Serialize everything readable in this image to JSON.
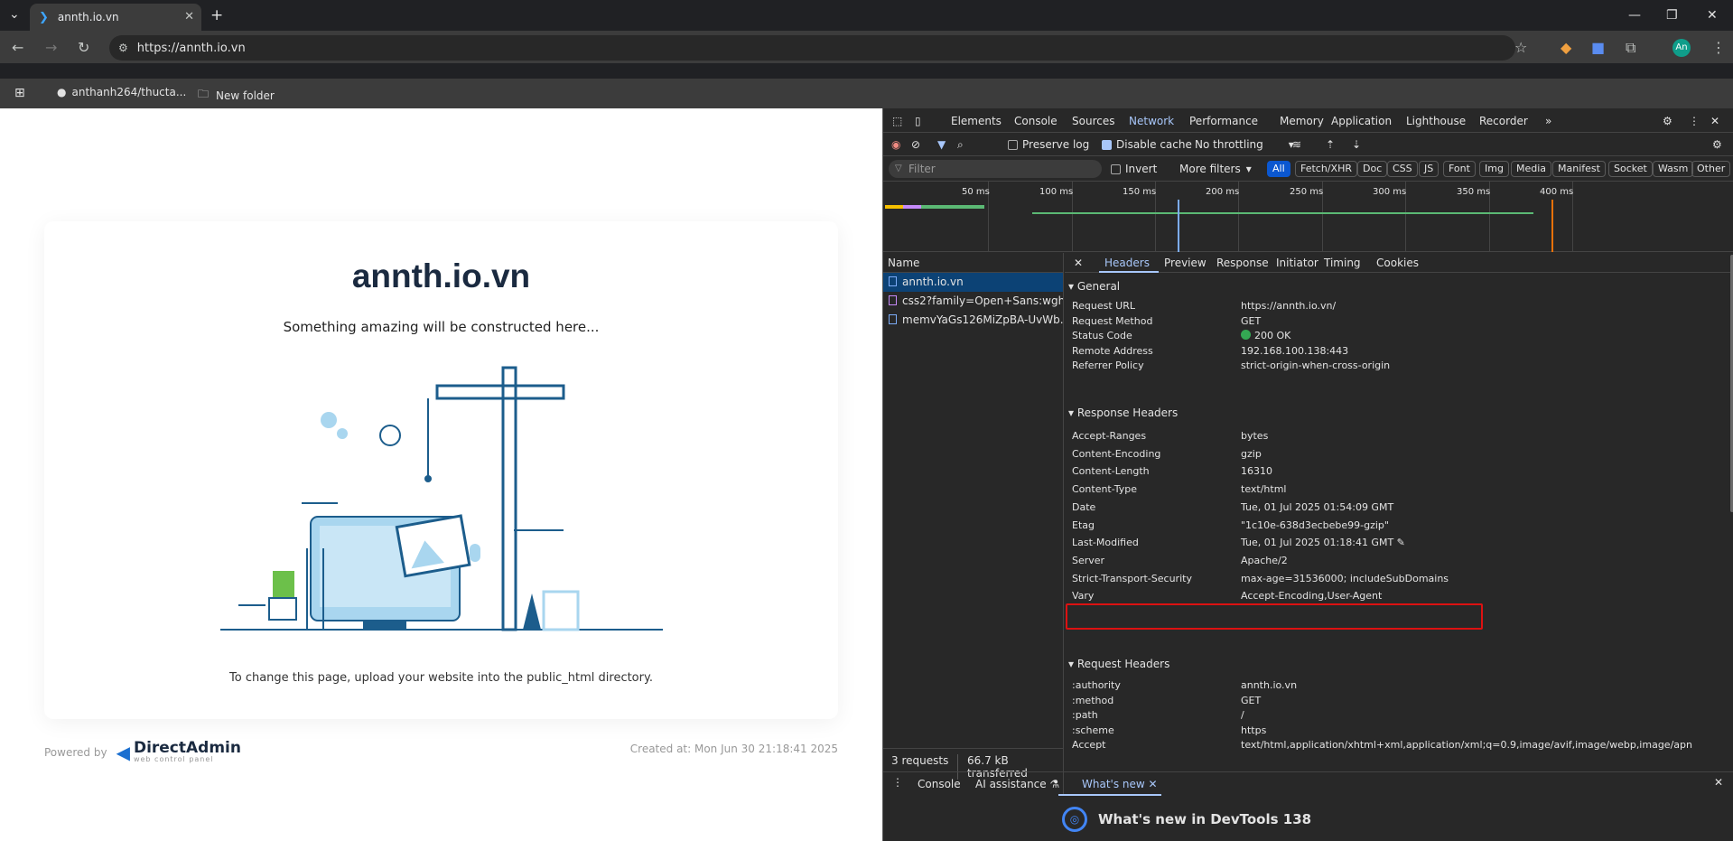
{
  "browser": {
    "tab_title": "annth.io.vn",
    "url": "https://annth.io.vn",
    "bookmarks": [
      "anthanh264/thucta...",
      "New folder"
    ],
    "profile": "An"
  },
  "page": {
    "title": "annth.io.vn",
    "subtitle": "Something amazing will be constructed here...",
    "footer_note": "To change this page, upload your website into the public_html directory.",
    "powered_by": "Powered by",
    "brand": "DirectAdmin",
    "brand_tag": "web control panel",
    "created": "Created at: Mon Jun 30 21:18:41 2025"
  },
  "devtools": {
    "tabs": [
      "Elements",
      "Console",
      "Sources",
      "Network",
      "Performance",
      "Memory",
      "Application",
      "Lighthouse",
      "Recorder"
    ],
    "net": {
      "preserve_log": "Preserve log",
      "disable_cache": "Disable cache",
      "throttling": "No throttling"
    },
    "filter": {
      "placeholder": "Filter",
      "invert": "Invert",
      "more": "More filters",
      "chips": [
        "All",
        "Fetch/XHR",
        "Doc",
        "CSS",
        "JS",
        "Font",
        "Img",
        "Media",
        "Manifest",
        "Socket",
        "Wasm",
        "Other"
      ]
    },
    "ticks": [
      "50 ms",
      "100 ms",
      "150 ms",
      "200 ms",
      "250 ms",
      "300 ms",
      "350 ms",
      "400 ms"
    ],
    "name_header": "Name",
    "requests": [
      "annth.io.vn",
      "css2?family=Open+Sans:wght...",
      "memvYaGs126MiZpBA-UvWb..."
    ],
    "status": {
      "count": "3 requests",
      "transferred": "66.7 kB transferred"
    },
    "detail_tabs": [
      "Headers",
      "Preview",
      "Response",
      "Initiator",
      "Timing",
      "Cookies"
    ],
    "general_title": "General",
    "general": [
      {
        "k": "Request URL",
        "v": "https://annth.io.vn/"
      },
      {
        "k": "Request Method",
        "v": "GET"
      },
      {
        "k": "Status Code",
        "v": "200 OK"
      },
      {
        "k": "Remote Address",
        "v": "192.168.100.138:443"
      },
      {
        "k": "Referrer Policy",
        "v": "strict-origin-when-cross-origin"
      }
    ],
    "response_title": "Response Headers",
    "response": [
      {
        "k": "Accept-Ranges",
        "v": "bytes"
      },
      {
        "k": "Content-Encoding",
        "v": "gzip"
      },
      {
        "k": "Content-Length",
        "v": "16310"
      },
      {
        "k": "Content-Type",
        "v": "text/html"
      },
      {
        "k": "Date",
        "v": "Tue, 01 Jul 2025 01:54:09 GMT"
      },
      {
        "k": "Etag",
        "v": "\"1c10e-638d3ecbebe99-gzip\""
      },
      {
        "k": "Last-Modified",
        "v": "Tue, 01 Jul 2025 01:18:41 GMT"
      },
      {
        "k": "Server",
        "v": "Apache/2"
      },
      {
        "k": "Strict-Transport-Security",
        "v": "max-age=31536000; includeSubDomains"
      },
      {
        "k": "Vary",
        "v": "Accept-Encoding,User-Agent"
      }
    ],
    "request_title": "Request Headers",
    "request": [
      {
        "k": ":authority",
        "v": "annth.io.vn"
      },
      {
        "k": ":method",
        "v": "GET"
      },
      {
        "k": ":path",
        "v": "/"
      },
      {
        "k": ":scheme",
        "v": "https"
      },
      {
        "k": "Accept",
        "v": "text/html,application/xhtml+xml,application/xml;q=0.9,image/avif,image/webp,image/apn"
      }
    ],
    "drawer": {
      "tabs": [
        "Console",
        "AI assistance",
        "What's new"
      ],
      "headline": "What's new in DevTools 138"
    }
  },
  "colors": {
    "accent": "#a8c7fa",
    "highlight": "#dd1111",
    "ok": "#34a853",
    "brand": "#1a2a40"
  }
}
